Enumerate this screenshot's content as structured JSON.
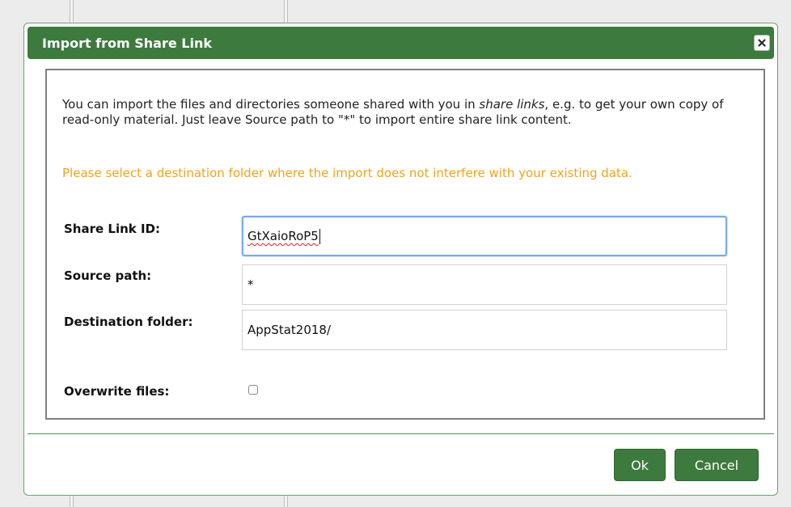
{
  "dialog": {
    "title": "Import from Share Link",
    "close_icon": "close-x-icon",
    "intro_text_before": "You can import the files and directories someone shared with you in ",
    "intro_text_emphasis": "share links",
    "intro_text_after": ", e.g. to get your own copy of read-only material. Just leave Source path to \"*\" to import entire share link content.",
    "warning_text": "Please select a destination folder where the import does not interfere with your existing data.",
    "fields": {
      "share_link_id": {
        "label": "Share Link ID:",
        "value": "GtXaioRoP5"
      },
      "source_path": {
        "label": "Source path:",
        "value": "*"
      },
      "destination_folder": {
        "label": "Destination folder:",
        "value": "AppStat2018/"
      },
      "overwrite_files": {
        "label": "Overwrite files:",
        "checked": false
      }
    },
    "buttons": {
      "ok_label": "Ok",
      "cancel_label": "Cancel"
    }
  },
  "colors": {
    "title_bar": "#3d7a3d",
    "warning": "#f5a31a",
    "focus_border": "#7aa9e8"
  }
}
